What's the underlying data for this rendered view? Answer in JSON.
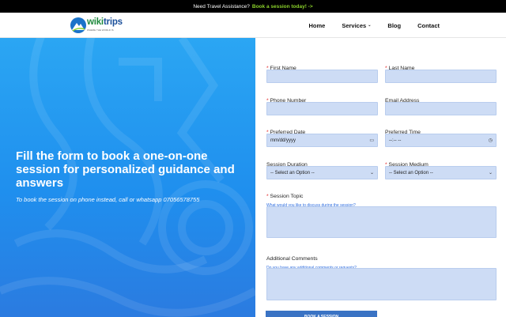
{
  "topbar": {
    "text": "Need Travel Assistance?",
    "cta": "Book a session today! ->"
  },
  "brand": {
    "name_part1": "wiki",
    "name_part2": "trips",
    "tagline": "WHERE THE WORLD IS"
  },
  "nav": {
    "items": [
      {
        "label": "Home"
      },
      {
        "label": "Services",
        "has_dropdown": true
      },
      {
        "label": "Blog"
      },
      {
        "label": "Contact"
      }
    ]
  },
  "hero": {
    "title": "Fill the form to book a one-on-one session for personalized guidance and answers",
    "subtitle": "To book the session on phone instead, call or whatsapp 07056578755"
  },
  "form": {
    "required_mark": "*",
    "first_name": {
      "label": "First Name",
      "required": true,
      "value": ""
    },
    "last_name": {
      "label": "Last Name",
      "required": true,
      "value": ""
    },
    "phone": {
      "label": "Phone Number",
      "required": true,
      "value": ""
    },
    "email": {
      "label": "Email Address",
      "required": false,
      "value": ""
    },
    "date": {
      "label": "Preferred Date",
      "required": true,
      "placeholder": "mm/dd/yyyy"
    },
    "time": {
      "label": "Preferred Time",
      "required": false,
      "placeholder": "--:-- --"
    },
    "duration": {
      "label": "Session Duration",
      "required": false,
      "selected": "-- Select an Option --"
    },
    "medium": {
      "label": "Session Medium",
      "required": true,
      "selected": "-- Select an Option --"
    },
    "topic": {
      "label": "Session Topic",
      "required": true,
      "help": "What would you like to discuss during the session?"
    },
    "comments": {
      "label": "Additional Comments",
      "required": false,
      "help": "Do you have any additional comments or requests?"
    },
    "submit": "BOOK A SESSION"
  },
  "colors": {
    "accent": "#8bd22b",
    "hero_blue": "#1f8fee",
    "input_bg": "#cddcf5",
    "button": "#3a73c4",
    "required": "#e02020"
  }
}
